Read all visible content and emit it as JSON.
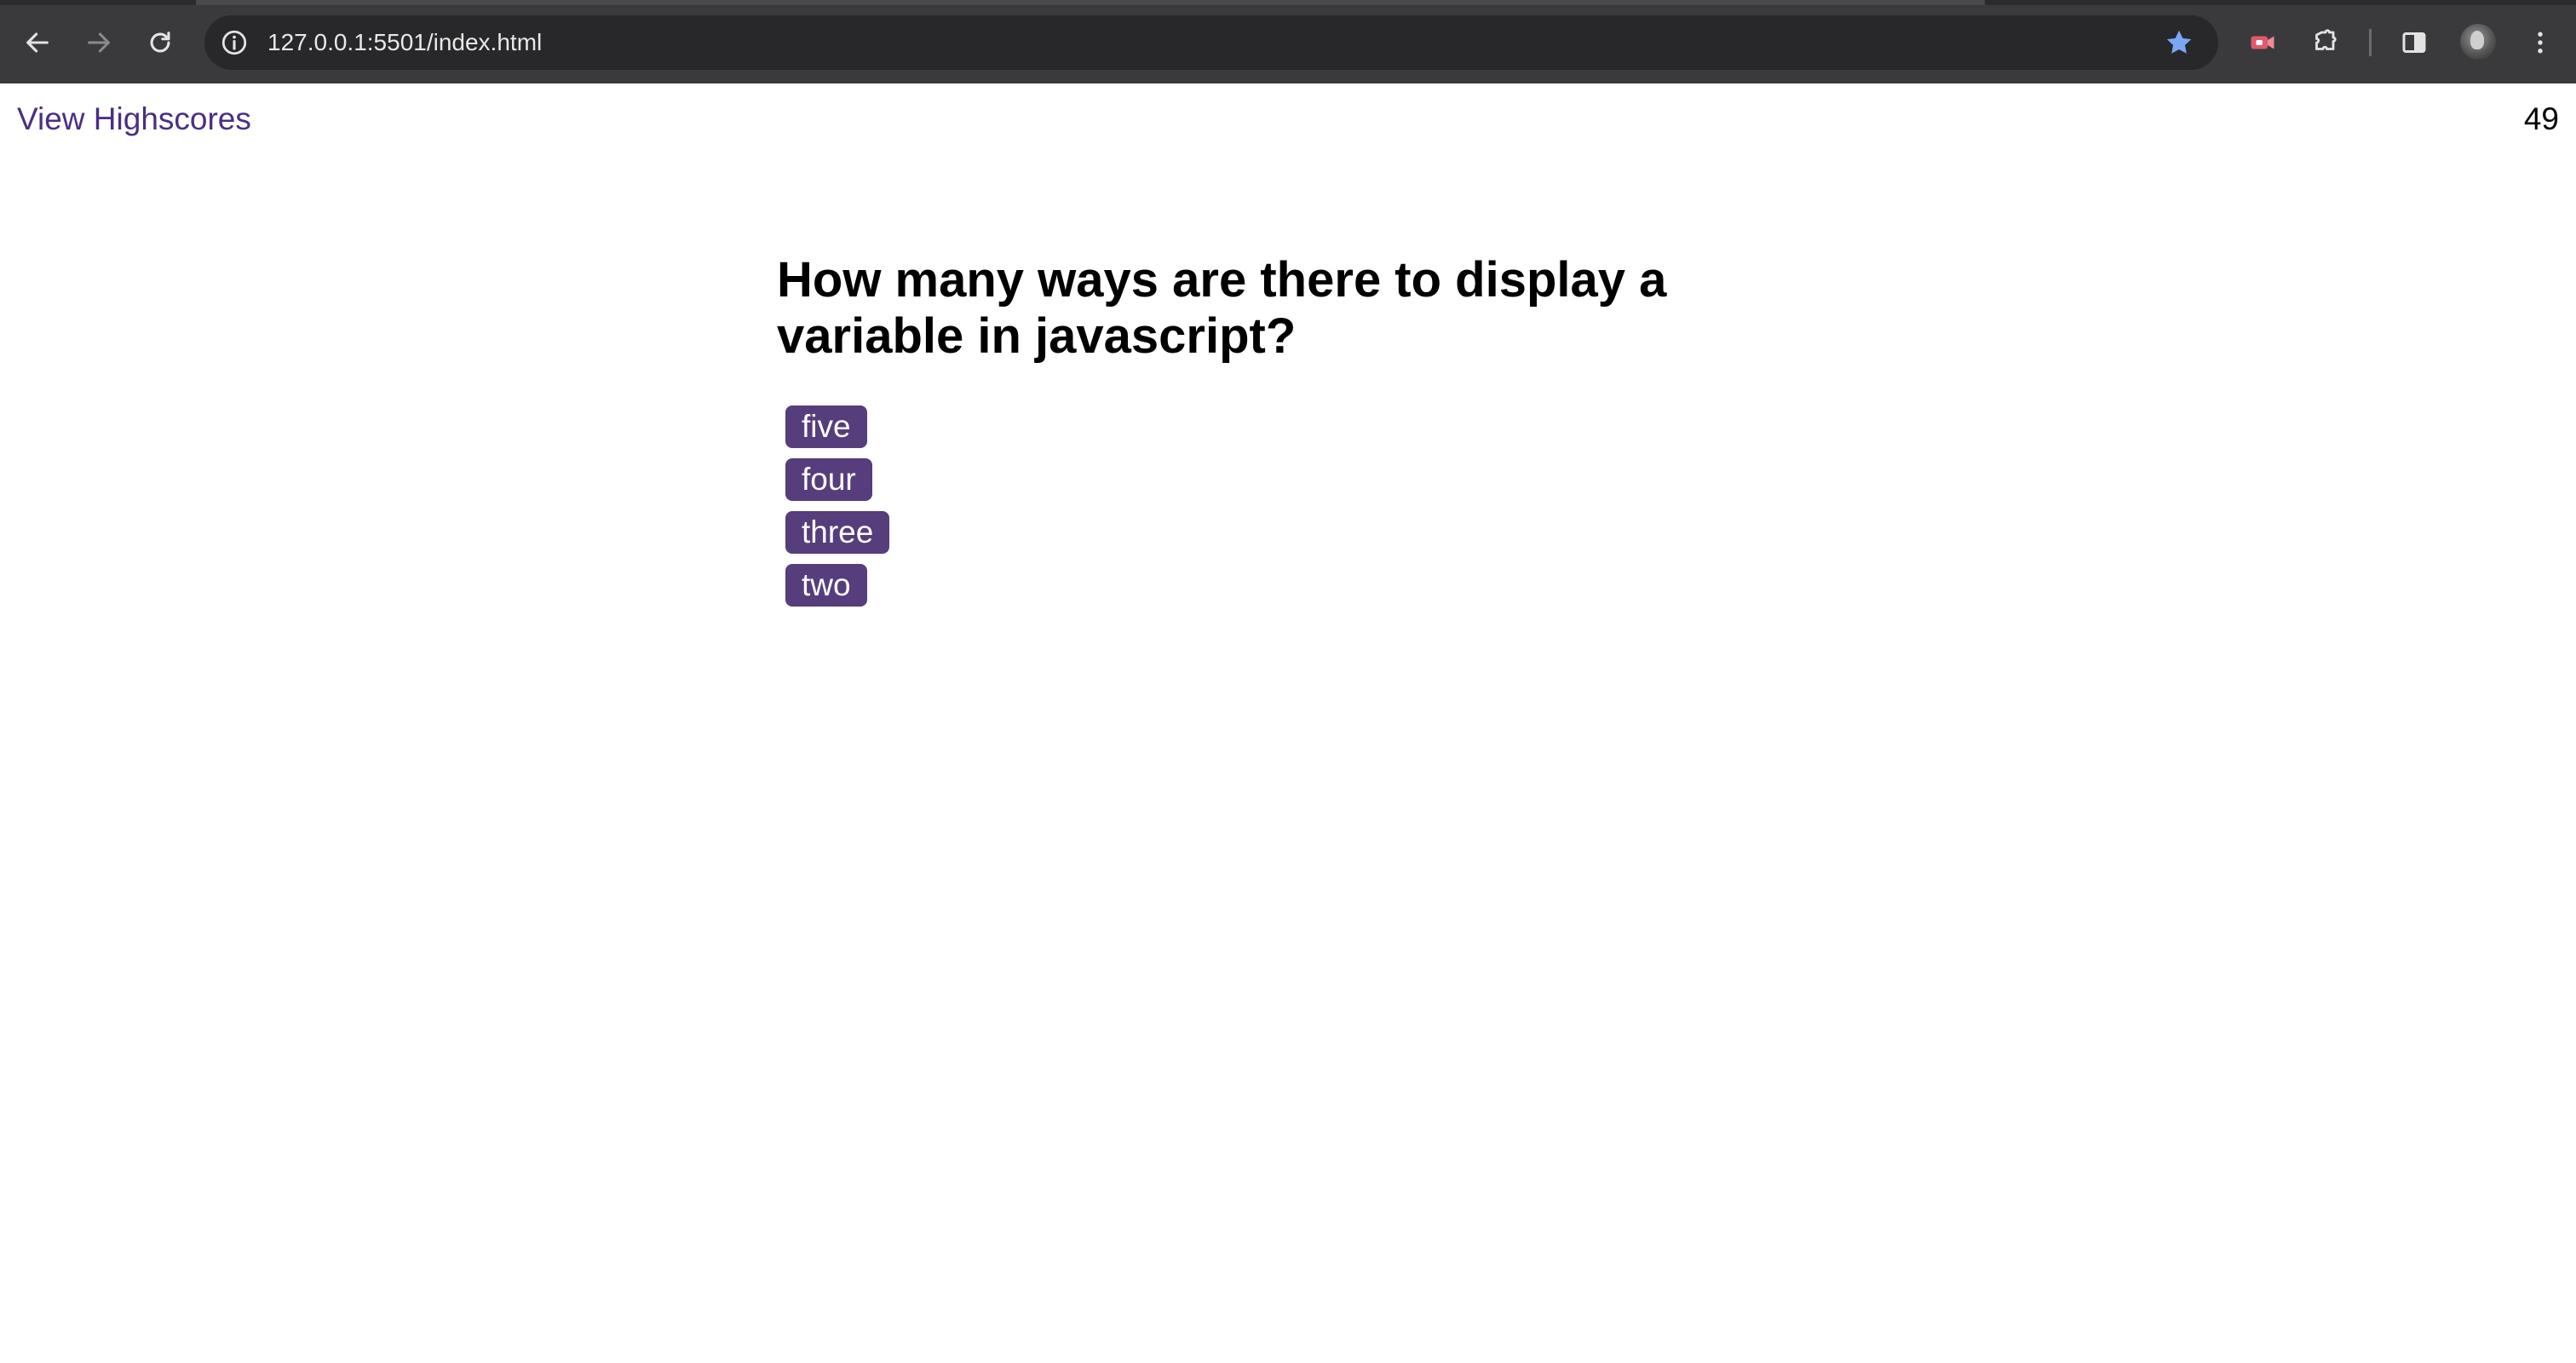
{
  "browser": {
    "url": "127.0.0.1:5501/index.html",
    "icons": [
      "back-icon",
      "forward-icon",
      "reload-icon",
      "site-info-icon",
      "bookmark-star-icon",
      "screen-recorder-extension-icon",
      "extensions-puzzle-icon",
      "side-panel-icon",
      "profile-avatar",
      "more-menu-icon"
    ],
    "star_color": "#7aa7f5"
  },
  "header": {
    "highscores_link": "View Highscores",
    "timer": "49"
  },
  "quiz": {
    "question": "How many ways are there to display a variable in javascript?",
    "answers": [
      {
        "label": "five"
      },
      {
        "label": "four"
      },
      {
        "label": "three"
      },
      {
        "label": "two"
      }
    ]
  },
  "colors": {
    "accent": "#563d7c",
    "link": "#4b2e83"
  }
}
